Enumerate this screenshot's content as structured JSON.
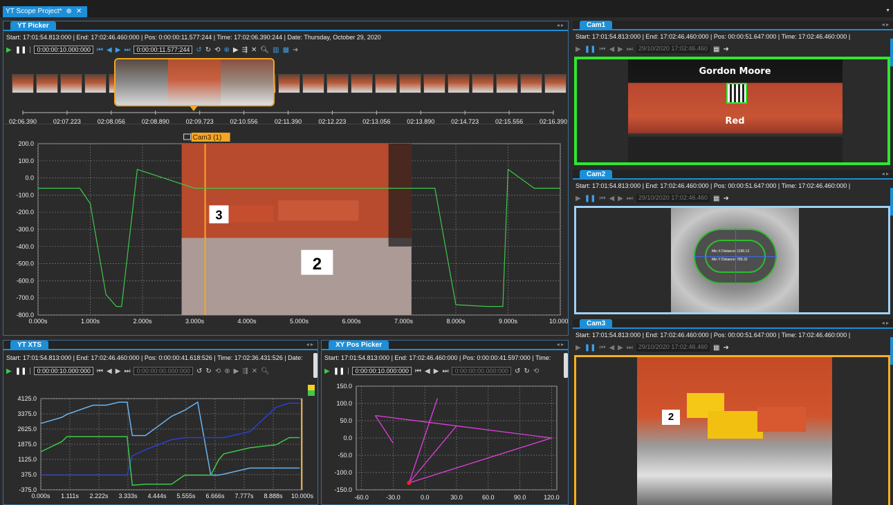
{
  "window": {
    "doc_tab": "YT Scope Project*",
    "pin": "⊕",
    "close": "✕"
  },
  "yt_picker": {
    "tab": "YT Picker",
    "info": "Start:  17:01:54.813:000 | End:  17:02:46.460:000 | Pos:  0:00:00:11.577:244 | Time:  17:02:06.390:244 | Date:   Thursday, October 29, 2020",
    "range_field": "0:00:00:10.000:000",
    "pos_field": "0:00:00:11.577:244",
    "timeline_ticks": [
      "02:06.390",
      "02:07.223",
      "02:08.056",
      "02:08.890",
      "02:09.723",
      "02:10.556",
      "02:11.390",
      "02:12.223",
      "02:13.056",
      "02:13.890",
      "02:14.723",
      "02:15.556",
      "02:16.390"
    ],
    "overlay_label": "Cam3 (1)",
    "y_ticks": [
      "200.0",
      "100.0",
      "0.0",
      "-100.0",
      "-200.0",
      "-300.0",
      "-400.0",
      "-500.0",
      "-600.0",
      "-700.0",
      "-800.0"
    ],
    "x_ticks": [
      "0.000s",
      "1.000s",
      "2.000s",
      "3.000s",
      "4.000s",
      "5.000s",
      "6.000s",
      "7.000s",
      "8.000s",
      "9.000s",
      "10.000s"
    ],
    "overlay_numbers": [
      "3",
      "2"
    ]
  },
  "yt_xts": {
    "tab": "YT XTS",
    "info": "Start:  17:01:54.813:000 | End:  17:02:46.460:000 | Pos:  0:00:00:41.618:526 | Time:  17:02:36.431:526 | Date:",
    "range_field": "0:00:00:10.000:000",
    "pos_field": "0:00:00:00.000:000",
    "y_ticks": [
      "4125.0",
      "3375.0",
      "2625.0",
      "1875.0",
      "1125.0",
      "375.0",
      "-375.0"
    ],
    "x_ticks": [
      "0.000s",
      "1.111s",
      "2.222s",
      "3.333s",
      "4.444s",
      "5.555s",
      "6.666s",
      "7.777s",
      "8.888s",
      "10.000s"
    ]
  },
  "xy_pos": {
    "tab": "XY Pos Picker",
    "info": "Start:  17:01:54.813:000 | End:  17:02:46.460:000 | Pos:  0:00:00:41.597:000 | Time:",
    "range_field": "0:00:00:10.000:000",
    "pos_field": "0:00:00:00.000:000",
    "y_ticks": [
      "150.0",
      "100.0",
      "50.0",
      "0.0",
      "-50.0",
      "-100.0",
      "-150.0"
    ],
    "x_ticks": [
      "-60.0",
      "-30.0",
      "0.0",
      "30.0",
      "60.0",
      "90.0",
      "120.0"
    ]
  },
  "cam1": {
    "tab": "Cam1",
    "info": "Start: 17:01:54.813:000 | End: 17:02:46.460:000 | Pos: 00:00:51.647:000 | Time: 17:02:46.460:000 |",
    "time_field": "29/10/2020 17:02:46.460",
    "name": "Gordon Moore",
    "color_label": "Red"
  },
  "cam2": {
    "tab": "Cam2",
    "info": "Start: 17:01:54.813:000 | End: 17:02:46.460:000 | Pos: 00:00:51.647:000 | Time: 17:02:46.460:000 |",
    "time_field": "29/10/2020 17:02:46.460",
    "min_x": "Min X Distance: 1190.13",
    "min_y": "Min Y Distance: 789.32"
  },
  "cam3": {
    "tab": "Cam3",
    "info": "Start: 17:01:54.813:000 | End: 17:02:46.460:000 | Pos: 00:00:51.647:000 | Time: 17:02:46.460:000 |",
    "time_field": "29/10/2020 17:02:46.460",
    "overlay_number": "2"
  },
  "colors": {
    "accent": "#1c8fd8",
    "green": "#3ec94a",
    "orange": "#f5a623",
    "magenta": "#e040e0",
    "lightblue": "#6ab4f0",
    "darkblue": "#2a3fd8",
    "cam1_border": "#2ee82e",
    "cam2_border": "#9fd3f5",
    "cam3_border": "#f5b020"
  },
  "chart_data": [
    {
      "type": "line",
      "title": "",
      "x": [
        0.0,
        0.6,
        0.8,
        1.0,
        1.3,
        1.5,
        1.6,
        1.9,
        3.0,
        3.5,
        4.2,
        4.6,
        5.0,
        6.0,
        6.5,
        6.8,
        7.0,
        7.6,
        8.0,
        8.6,
        8.9,
        9.0,
        9.5,
        10.0
      ],
      "series": [
        {
          "values": [
            -60,
            -60,
            -60,
            -150,
            -680,
            -750,
            -750,
            50,
            -60,
            -60,
            -60,
            -60,
            -60,
            -60,
            -60,
            -60,
            -60,
            -60,
            -740,
            -750,
            -750,
            50,
            -60,
            -60
          ]
        }
      ],
      "ylim": [
        -800,
        200
      ],
      "xlim": [
        0,
        10
      ],
      "grid": true
    },
    {
      "type": "line",
      "title": "",
      "x": [
        0.0,
        0.8,
        1.0,
        2.0,
        2.5,
        3.0,
        3.3,
        3.5,
        4.0,
        5.0,
        5.5,
        6.0,
        6.5,
        6.8,
        7.0,
        8.0,
        9.0,
        9.5,
        9.9
      ],
      "series": [
        {
          "values": [
            2900,
            3200,
            3350,
            3800,
            3800,
            3950,
            3950,
            2300,
            2300,
            3250,
            3550,
            3950,
            350,
            350,
            400,
            700,
            700,
            700,
            700
          ]
        },
        {
          "values": [
            350,
            350,
            350,
            350,
            350,
            350,
            350,
            1300,
            1600,
            2100,
            2200,
            2200,
            2200,
            2200,
            2200,
            2500,
            3700,
            3900,
            3900
          ]
        },
        {
          "values": [
            1500,
            2000,
            2250,
            2250,
            2250,
            2250,
            2250,
            -150,
            -100,
            -100,
            350,
            350,
            350,
            1100,
            1400,
            1700,
            1850,
            2200,
            2200
          ]
        }
      ],
      "ylim": [
        -375,
        4125
      ],
      "xlim": [
        0,
        10
      ],
      "grid": true
    },
    {
      "type": "scatter",
      "title": "",
      "x": [
        -47,
        -30,
        -22,
        -15,
        12,
        30,
        120,
        -15,
        -47
      ],
      "y": [
        65,
        -15,
        -70,
        -130,
        115,
        35,
        0,
        -130,
        65
      ],
      "ylim": [
        -150,
        150
      ],
      "xlim": [
        -65,
        125
      ],
      "grid": true
    }
  ]
}
